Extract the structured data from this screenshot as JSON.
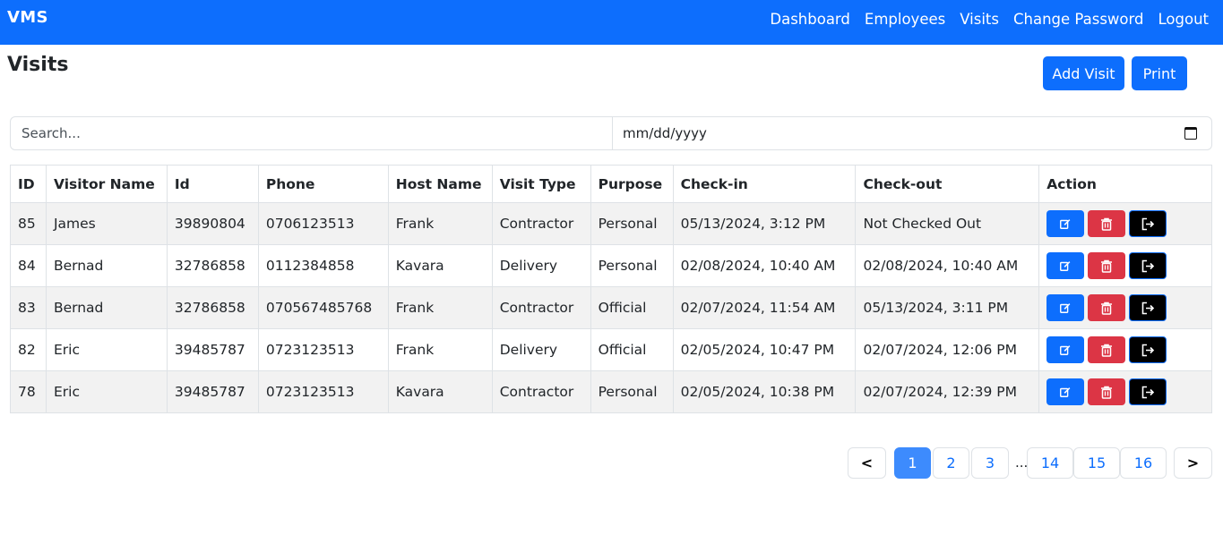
{
  "app": {
    "brand": "VMS",
    "nav": [
      "Dashboard",
      "Employees",
      "Visits",
      "Change Password",
      "Logout"
    ]
  },
  "page": {
    "title": "Visits",
    "add_label": "Add Visit",
    "print_label": "Print"
  },
  "filters": {
    "search_placeholder": "Search...",
    "date_placeholder": "mm/dd/yyyy"
  },
  "table": {
    "columns": [
      "ID",
      "Visitor Name",
      "Id",
      "Phone",
      "Host Name",
      "Visit Type",
      "Purpose",
      "Check-in",
      "Check-out",
      "Action"
    ],
    "rows": [
      [
        "85",
        "James",
        "39890804",
        "0706123513",
        "Frank",
        "Contractor",
        "Personal",
        "05/13/2024, 3:12 PM",
        "Not Checked Out"
      ],
      [
        "84",
        "Bernad",
        "32786858",
        "0112384858",
        "Kavara",
        "Delivery",
        "Personal",
        "02/08/2024, 10:40 AM",
        "02/08/2024, 10:40 AM"
      ],
      [
        "83",
        "Bernad",
        "32786858",
        "070567485768",
        "Frank",
        "Contractor",
        "Official",
        "02/07/2024, 11:54 AM",
        "05/13/2024, 3:11 PM"
      ],
      [
        "82",
        "Eric",
        "39485787",
        "0723123513",
        "Frank",
        "Delivery",
        "Official",
        "02/05/2024, 10:47 PM",
        "02/07/2024, 12:06 PM"
      ],
      [
        "78",
        "Eric",
        "39485787",
        "0723123513",
        "Kavara",
        "Contractor",
        "Personal",
        "02/05/2024, 10:38 PM",
        "02/07/2024, 12:39 PM"
      ]
    ],
    "row_actions": [
      "edit-icon",
      "trash-icon",
      "checkout-icon"
    ]
  },
  "pagination": {
    "prev": "<",
    "next": ">",
    "pages": [
      "1",
      "2",
      "3",
      "14",
      "15",
      "16"
    ],
    "ellipsis": "...",
    "current": "1"
  },
  "colors": {
    "primary": "#0d6efd",
    "danger": "#dc3545",
    "row_stripe": "#f2f2f2"
  }
}
